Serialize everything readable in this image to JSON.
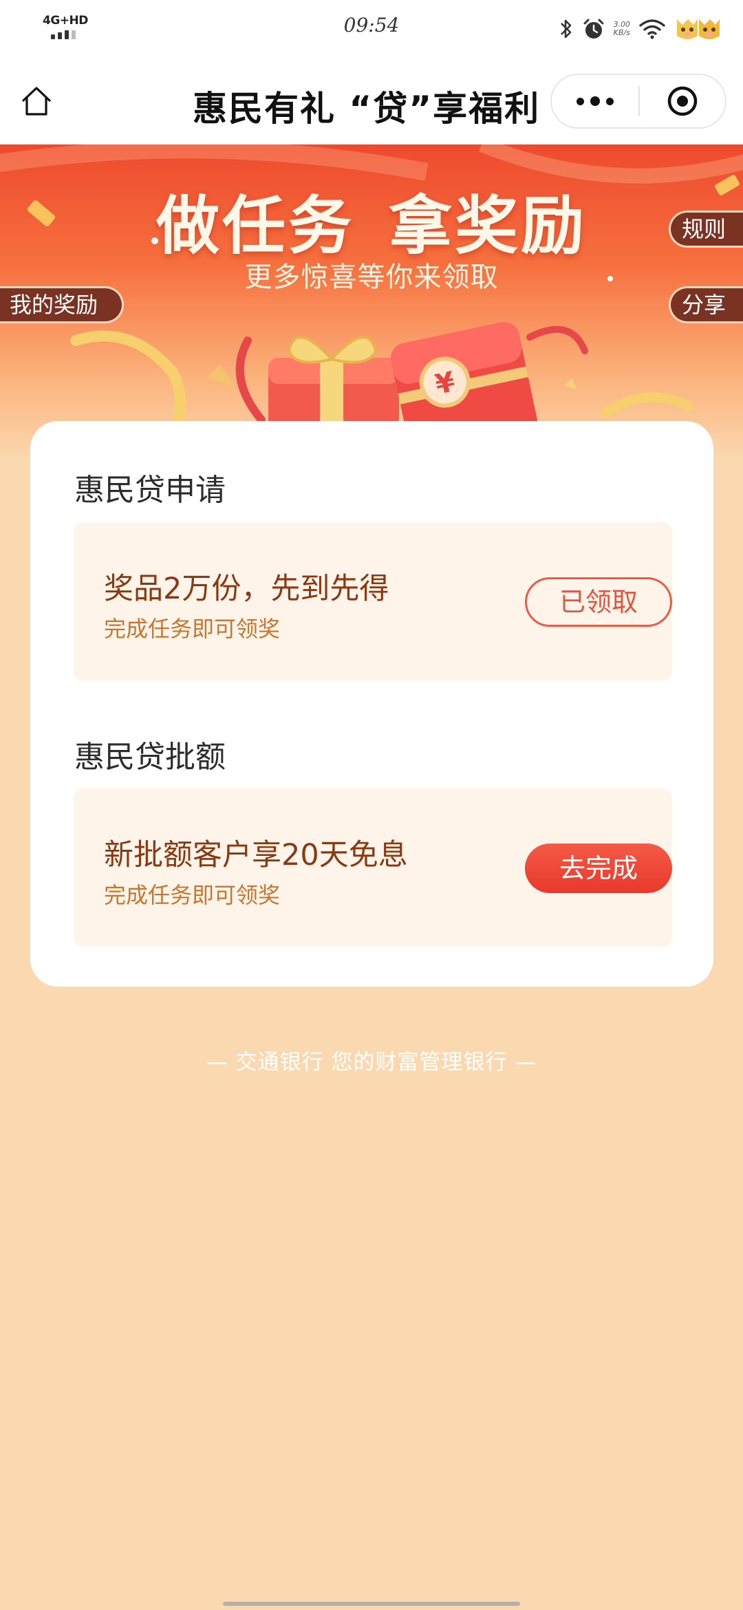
{
  "status_bar": {
    "network": "4G+HD",
    "time": "09:54",
    "speed_value": "3.00",
    "speed_unit": "KB/s"
  },
  "title_bar": {
    "title": "惠民有礼 “贷”享福利"
  },
  "banner": {
    "title": "做任务 拿奖励",
    "subtitle": "更多惊喜等你来领取",
    "rules_label": "规则",
    "share_label": "分享",
    "my_rewards_label": "我的奖励"
  },
  "tasks": [
    {
      "section_title": "惠民贷申请",
      "main_text": "奖品2万份，先到先得",
      "sub_text": "完成任务即可领奖",
      "button_label": "已领取",
      "status": "claimed"
    },
    {
      "section_title": "惠民贷批额",
      "main_text": "新批额客户享20天免息",
      "sub_text": "完成任务即可领奖",
      "button_label": "去完成",
      "status": "todo"
    }
  ],
  "footer": {
    "text": "— 交通银行 您的财富管理银行 —"
  },
  "colors": {
    "page_background": "#fbd9b0",
    "banner_red": "#ee4a2e",
    "button_red": "#e8382c",
    "task_text_brown": "#8a3a13",
    "task_sub_orange": "#c6762e",
    "side_tab_brown": "#7a3222"
  },
  "icons": {
    "home": "home-icon",
    "more": "more-dots-icon",
    "close": "target-close-icon",
    "bluetooth": "bluetooth-icon",
    "alarm": "alarm-icon",
    "wifi": "wifi-icon"
  }
}
